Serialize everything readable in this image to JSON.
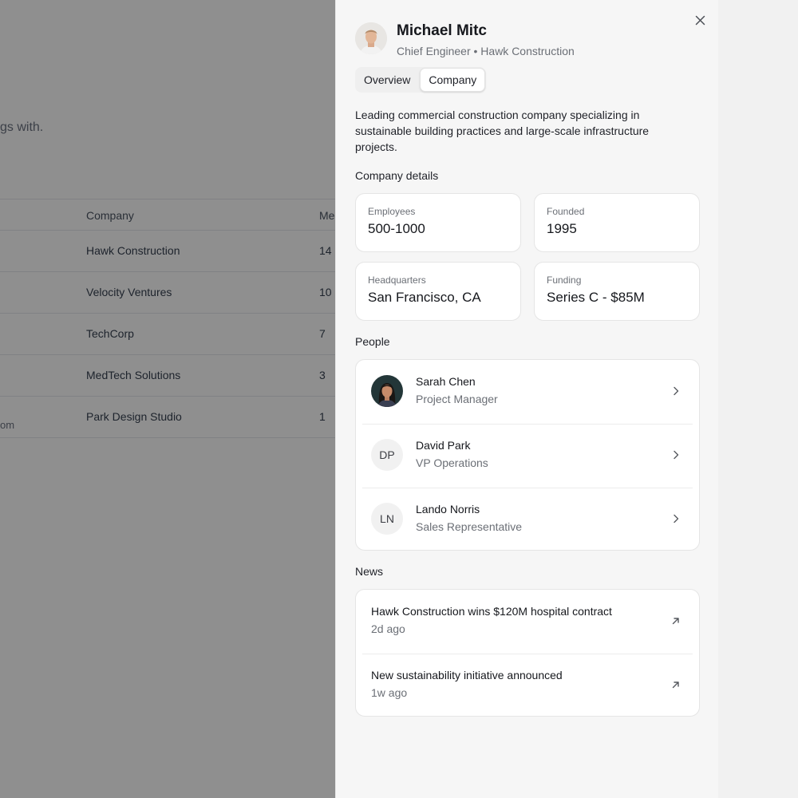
{
  "background": {
    "partial_text": "gs with.",
    "table_headers": {
      "company": "Company",
      "meetings_partial": "Me"
    },
    "rows": [
      {
        "company": "Hawk Construction",
        "meetings": "14",
        "left_partial": ""
      },
      {
        "company": "Velocity Ventures",
        "meetings": "10",
        "left_partial": ""
      },
      {
        "company": "TechCorp",
        "meetings": "7",
        "left_partial": ""
      },
      {
        "company": "MedTech Solutions",
        "meetings": "3",
        "left_partial": ""
      },
      {
        "company": "Park Design Studio",
        "meetings": "1",
        "left_partial": "om"
      }
    ]
  },
  "panel": {
    "name": "Michael Mitc",
    "subtitle": "Chief Engineer • Hawk Construction",
    "tabs": [
      {
        "label": "Overview",
        "active": false
      },
      {
        "label": "Company",
        "active": true
      }
    ],
    "description": "Leading commercial construction company specializing in sustainable building practices and large-scale infrastructure projects.",
    "company_details": {
      "title": "Company details",
      "employees": {
        "label": "Employees",
        "value": "500-1000"
      },
      "founded": {
        "label": "Founded",
        "value": "1995"
      },
      "headquarters": {
        "label": "Headquarters",
        "value": "San Francisco, CA"
      },
      "funding": {
        "label": "Funding",
        "value": "Series C - $85M"
      }
    },
    "people": {
      "title": "People",
      "items": [
        {
          "name": "Sarah Chen",
          "role": "Project Manager",
          "initials": ""
        },
        {
          "name": "David Park",
          "role": "VP Operations",
          "initials": "DP"
        },
        {
          "name": "Lando Norris",
          "role": "Sales Representative",
          "initials": "LN"
        }
      ]
    },
    "news": {
      "title": "News",
      "items": [
        {
          "title": "Hawk Construction wins $120M hospital contract",
          "time": "2d ago"
        },
        {
          "title": "New sustainability initiative announced",
          "time": "1w ago"
        }
      ]
    }
  },
  "icons": {
    "close": "close-icon",
    "chevron": "chevron-right-icon",
    "external": "arrow-up-right-icon"
  },
  "colors": {
    "overlay": "#707070",
    "panel_bg": "#f6f6f6",
    "card_bg": "#ffffff",
    "text_primary": "#16181d",
    "text_secondary": "#6b6f76"
  }
}
